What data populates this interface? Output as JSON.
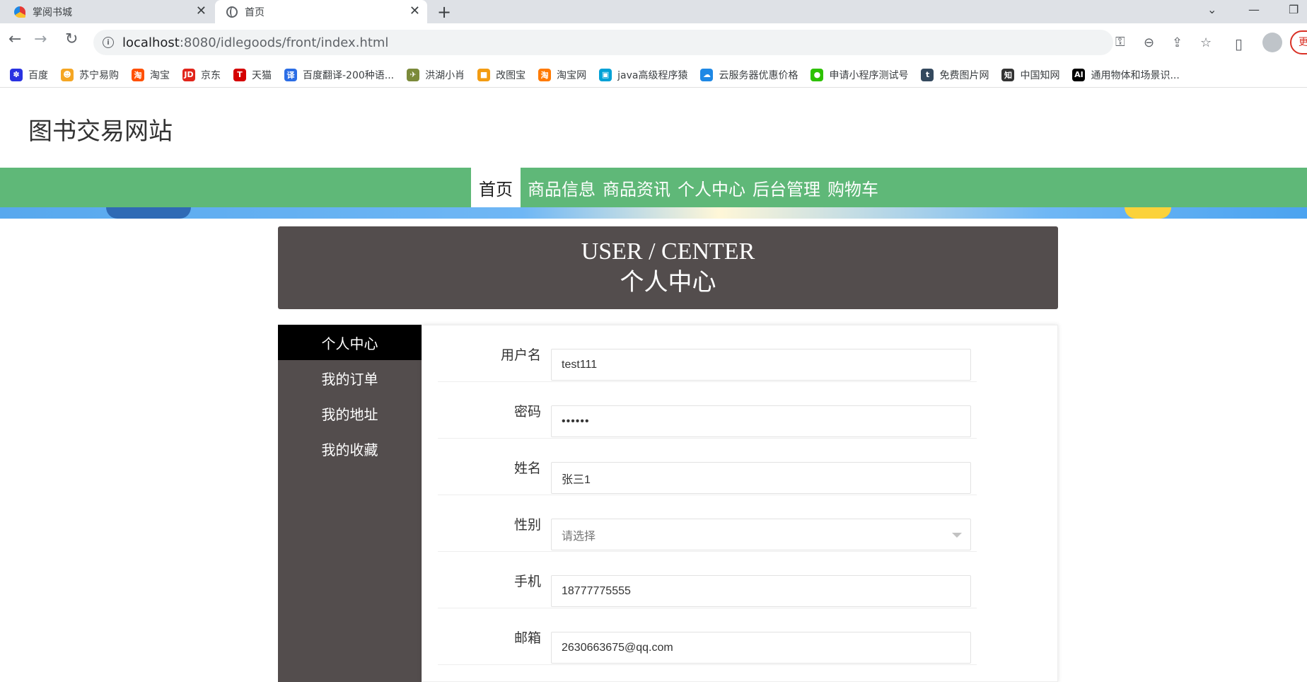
{
  "browser": {
    "tabs": [
      {
        "title": "掌阅书城",
        "favicon": "book-app-icon"
      },
      {
        "title": "首页",
        "favicon": "globe-icon"
      }
    ],
    "url_host": "localhost",
    "url_rest": ":8080/idlegoods/front/index.html",
    "update_label": "更",
    "bookmarks": [
      {
        "label": "百度",
        "icon": "baidu-icon",
        "color": "#2932e1",
        "glyph": "✽"
      },
      {
        "label": "苏宁易购",
        "icon": "suning-icon",
        "color": "#f5a623",
        "glyph": "☻"
      },
      {
        "label": "淘宝",
        "icon": "taobao-icon",
        "color": "#ff5000",
        "glyph": "淘"
      },
      {
        "label": "京东",
        "icon": "jd-icon",
        "color": "#e1251b",
        "glyph": "JD"
      },
      {
        "label": "天猫",
        "icon": "tmall-icon",
        "color": "#d50000",
        "glyph": "T"
      },
      {
        "label": "百度翻译-200种语...",
        "icon": "baidu-translate-icon",
        "color": "#2b6de5",
        "glyph": "译"
      },
      {
        "label": "洪湖小肖",
        "icon": "bird-icon",
        "color": "#7b8a3a",
        "glyph": "✈"
      },
      {
        "label": "改图宝",
        "icon": "gaitubao-icon",
        "color": "#f39c12",
        "glyph": "■"
      },
      {
        "label": "淘宝网",
        "icon": "taobao-icon",
        "color": "#ff7a00",
        "glyph": "淘"
      },
      {
        "label": "java高级程序猿",
        "icon": "bilibili-icon",
        "color": "#00a1d6",
        "glyph": "▣"
      },
      {
        "label": "云服务器优惠价格",
        "icon": "cloud-icon",
        "color": "#1e88e5",
        "glyph": "☁"
      },
      {
        "label": "申请小程序测试号",
        "icon": "wechat-icon",
        "color": "#2dc100",
        "glyph": "●"
      },
      {
        "label": "免费图片网",
        "icon": "t-circle-icon",
        "color": "#34495e",
        "glyph": "t"
      },
      {
        "label": "中国知网",
        "icon": "cnki-icon",
        "color": "#333333",
        "glyph": "知"
      },
      {
        "label": "通用物体和场景识...",
        "icon": "ai-icon",
        "color": "#000000",
        "glyph": "AI"
      }
    ]
  },
  "site": {
    "title": "图书交易网站",
    "nav": [
      "首页",
      "商品信息",
      "商品资讯",
      "个人中心",
      "后台管理",
      "购物车"
    ]
  },
  "center": {
    "title_en": "USER / CENTER",
    "title_cn": "个人中心",
    "menu": [
      "个人中心",
      "我的订单",
      "我的地址",
      "我的收藏"
    ]
  },
  "form": {
    "fields": [
      {
        "label": "用户名",
        "value": "test111"
      },
      {
        "label": "密码",
        "value": "••••••"
      },
      {
        "label": "姓名",
        "value": "张三1"
      },
      {
        "label": "性别",
        "value": "请选择"
      },
      {
        "label": "手机",
        "value": "18777775555"
      },
      {
        "label": "邮箱",
        "value": "2630663675@qq.com"
      }
    ]
  },
  "colors": {
    "nav_green": "#5fb878",
    "panel_dark": "#534d4d"
  }
}
